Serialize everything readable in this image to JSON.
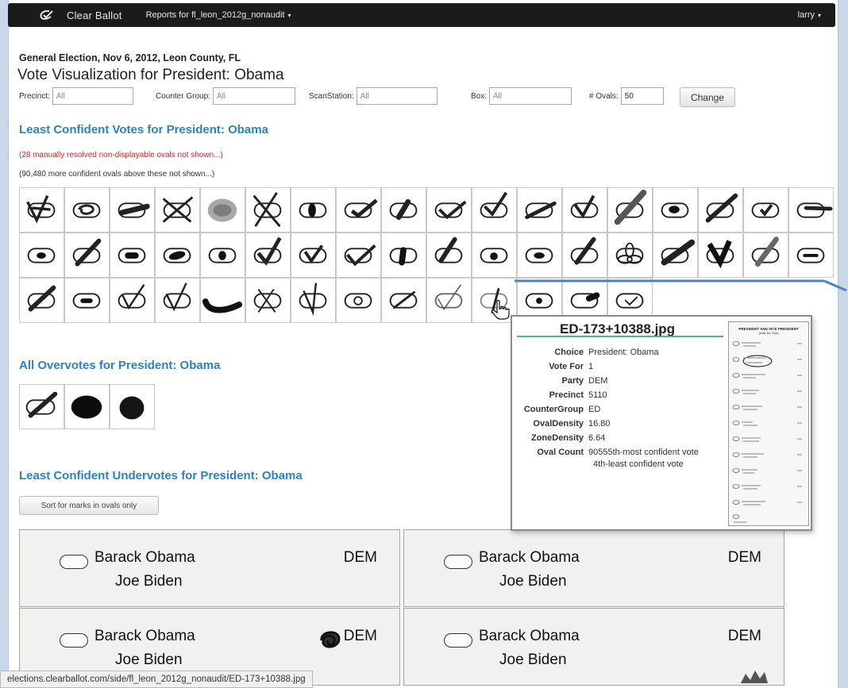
{
  "navbar": {
    "brand": "Clear Ballot",
    "report_menu": "Reports for fl_leon_2012g_nonaudit",
    "user_menu": "larry"
  },
  "header": {
    "election": "General Election, Nov 6, 2012, Leon County, FL",
    "title": "Vote Visualization for President: Obama"
  },
  "filters": {
    "precinct_label": "Precinct:",
    "precinct_value": "All",
    "counter_group_label": "Counter Group:",
    "counter_group_value": "All",
    "scan_station_label": "ScanStation:",
    "scan_station_value": "All",
    "box_label": "Box:",
    "box_value": "All",
    "ovals_label": "# Ovals:",
    "ovals_value": "50",
    "change_label": "Change"
  },
  "least_confident": {
    "heading": "Least Confident Votes for President: Obama",
    "manual_note": "(28 manually resolved non-displayable ovals not shown...)",
    "more_note": "(90,480 more confident ovals above these not shown...)"
  },
  "overvotes": {
    "heading": "All Overvotes for President: Obama"
  },
  "undervotes": {
    "heading": "Least Confident Undervotes for President: Obama",
    "sort_button": "Sort for marks in ovals only",
    "ballots": [
      {
        "candidate": "Barack Obama",
        "running_mate": "Joe Biden",
        "party": "DEM"
      },
      {
        "candidate": "Barack Obama",
        "running_mate": "Joe Biden",
        "party": "DEM"
      },
      {
        "candidate": "Barack Obama",
        "running_mate": "Joe Biden",
        "party": "DEM"
      },
      {
        "candidate": "Barack Obama",
        "running_mate": "Joe Biden",
        "party": "DEM"
      }
    ]
  },
  "popup": {
    "filename": "ED-173+10388.jpg",
    "rows": [
      {
        "key": "Choice",
        "value": "President: Obama"
      },
      {
        "key": "Vote For",
        "value": "1"
      },
      {
        "key": "Party",
        "value": "DEM"
      },
      {
        "key": "Precinct",
        "value": "5110"
      },
      {
        "key": "CounterGroup",
        "value": "ED"
      },
      {
        "key": "OvalDensity",
        "value": "16.80"
      },
      {
        "key": "ZoneDensity",
        "value": "6.64"
      },
      {
        "key": "Oval Count",
        "value": "90555th-most confident vote"
      }
    ],
    "extra_line": "4th-least confident vote",
    "thumbnail_heading": "PRESIDENT AND VICE PRESIDENT",
    "thumbnail_subheading": "(Vote for One)"
  },
  "status_bar": {
    "url": "elections.clearballot.com/side/fl_leon_2012g_nonaudit/ED-173+10388.jpg"
  }
}
